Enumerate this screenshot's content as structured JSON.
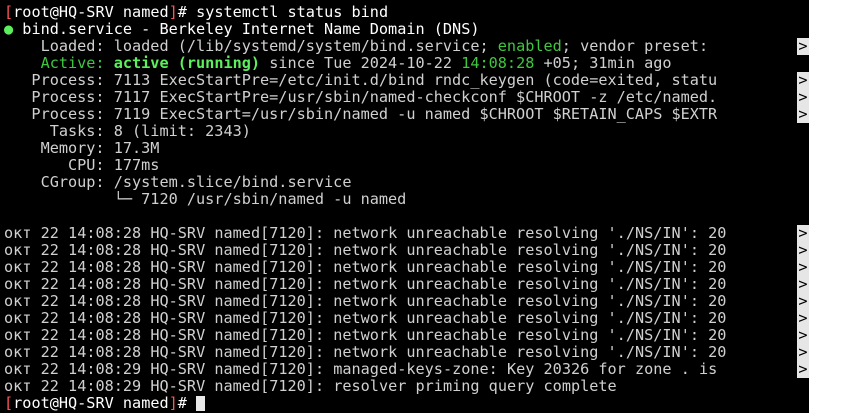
{
  "prompt": {
    "open": "[",
    "user_host": "root@HQ-SRV",
    "space": " ",
    "dir": "named",
    "close": "]",
    "hash": "# "
  },
  "command": "systemctl status bind",
  "status_line": {
    "dot": "●",
    "text": " bind.service - Berkeley Internet Name Domain (DNS)"
  },
  "loaded": {
    "label": "    Loaded: ",
    "value_pre": "loaded (/lib/systemd/system/bind.service; ",
    "enabled": "enabled",
    "value_post": "; vendor preset: "
  },
  "active": {
    "label": "    Active: ",
    "state": "active (running)",
    "since_pre": " since Tue 2024-10-22 ",
    "since_time": "14:08:28",
    "since_post": " +05; 31min ago"
  },
  "processes": [
    "   Process: 7113 ExecStartPre=/etc/init.d/bind rndc_keygen (code=exited, statu",
    "   Process: 7117 ExecStartPre=/usr/sbin/named-checkconf $CHROOT -z /etc/named.",
    "   Process: 7119 ExecStart=/usr/sbin/named -u named $CHROOT $RETAIN_CAPS $EXTR"
  ],
  "details": [
    "     Tasks: 8 (limit: 2343)",
    "    Memory: 17.3M",
    "       CPU: 177ms",
    "    CGroup: /system.slice/bind.service",
    "            └─ 7120 /usr/sbin/named -u named"
  ],
  "log_lines": [
    {
      "month": "окт",
      "day": "22",
      "time": "14:08:28",
      "text": "HQ-SRV named[7120]: network unreachable resolving './NS/IN': 20",
      "truncated": true
    },
    {
      "month": "окт",
      "day": "22",
      "time": "14:08:28",
      "text": "HQ-SRV named[7120]: network unreachable resolving './NS/IN': 20",
      "truncated": true
    },
    {
      "month": "окт",
      "day": "22",
      "time": "14:08:28",
      "text": "HQ-SRV named[7120]: network unreachable resolving './NS/IN': 20",
      "truncated": true
    },
    {
      "month": "окт",
      "day": "22",
      "time": "14:08:28",
      "text": "HQ-SRV named[7120]: network unreachable resolving './NS/IN': 20",
      "truncated": true
    },
    {
      "month": "окт",
      "day": "22",
      "time": "14:08:28",
      "text": "HQ-SRV named[7120]: network unreachable resolving './NS/IN': 20",
      "truncated": true
    },
    {
      "month": "окт",
      "day": "22",
      "time": "14:08:28",
      "text": "HQ-SRV named[7120]: network unreachable resolving './NS/IN': 20",
      "truncated": true
    },
    {
      "month": "окт",
      "day": "22",
      "time": "14:08:28",
      "text": "HQ-SRV named[7120]: network unreachable resolving './NS/IN': 20",
      "truncated": true
    },
    {
      "month": "окт",
      "day": "22",
      "time": "14:08:28",
      "text": "HQ-SRV named[7120]: network unreachable resolving './NS/IN': 20",
      "truncated": true
    },
    {
      "month": "окт",
      "day": "22",
      "time": "14:08:29",
      "text": "HQ-SRV named[7120]: managed-keys-zone: Key 20326 for zone . is ",
      "truncated": true
    },
    {
      "month": "окт",
      "day": "22",
      "time": "14:08:29",
      "text": "HQ-SRV named[7120]: resolver priming query complete",
      "truncated": false
    }
  ],
  "truncation_marker": ">",
  "colors": {
    "background": "#000000",
    "foreground": "#d0d0d0",
    "prompt_bracket": "#ff5555",
    "active_green": "#5cf05c",
    "enabled_green": "#3fc83f"
  }
}
